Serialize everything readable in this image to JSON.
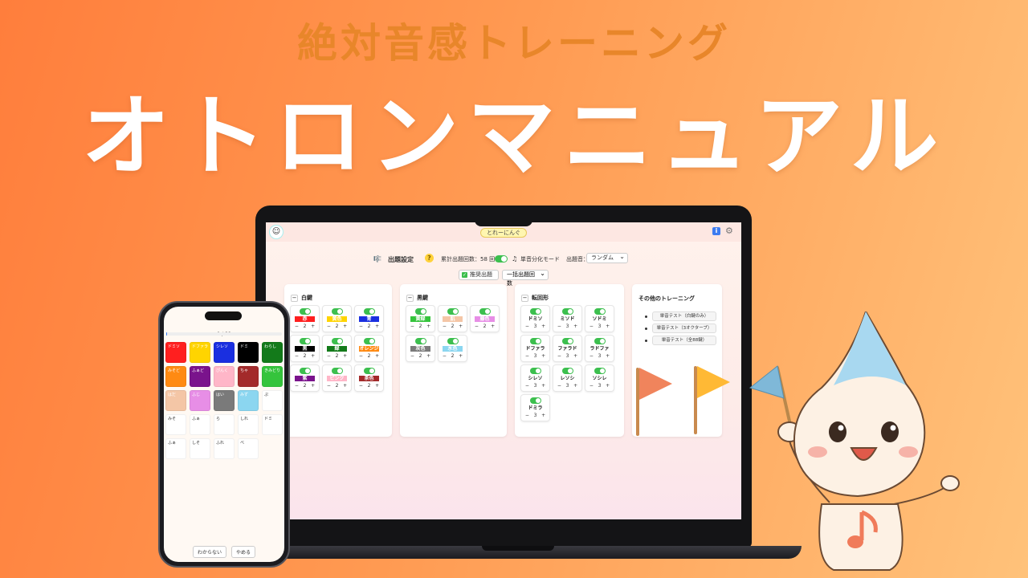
{
  "hero": {
    "subtitle": "絶対音感トレーニング",
    "title": "オトロンマニュアル"
  },
  "app": {
    "profile_name": "とれーにんぐ",
    "info_label": "i",
    "settings": {
      "title": "出題設定",
      "count_label": "累計出題回数：58 回",
      "mode_label": "単音分化モード",
      "sound_label": "出題音：",
      "sound_value": "ランダム",
      "recommend_label": "推奨出題",
      "bulk_label": "一括出題回数"
    },
    "white_keys": {
      "title": "白鍵",
      "cards": [
        {
          "label": "赤",
          "color": "#ff1f1f",
          "count": "2"
        },
        {
          "label": "黄色",
          "color": "#ffd400",
          "count": "2"
        },
        {
          "label": "青",
          "color": "#1a2fe0",
          "count": "2"
        },
        {
          "label": "黒",
          "color": "#000000",
          "count": "2"
        },
        {
          "label": "緑",
          "color": "#137a1a",
          "count": "2"
        },
        {
          "label": "オレンジ",
          "color": "#ff8a12",
          "count": "2"
        },
        {
          "label": "紫",
          "color": "#7a138c",
          "count": "2"
        },
        {
          "label": "ピンク",
          "color": "#ffb6c8",
          "count": "2"
        },
        {
          "label": "茶色",
          "color": "#a32a2a",
          "count": "2"
        }
      ]
    },
    "black_keys": {
      "title": "黒鍵",
      "cards": [
        {
          "label": "黄緑",
          "color": "#35c43c",
          "count": "2"
        },
        {
          "label": "肌",
          "color": "#f4c6a6",
          "count": "2"
        },
        {
          "label": "藤色",
          "color": "#e78ee6",
          "count": "2"
        },
        {
          "label": "灰色",
          "color": "#7a7a7a",
          "count": "2"
        },
        {
          "label": "水色",
          "color": "#8bd6f0",
          "count": "2"
        }
      ]
    },
    "inversions": {
      "title": "転回形",
      "cards": [
        {
          "label": "ドミソ",
          "count": "3"
        },
        {
          "label": "ミソド",
          "count": "3"
        },
        {
          "label": "ソドミ",
          "count": "3"
        },
        {
          "label": "ドファラ",
          "count": "3"
        },
        {
          "label": "ファラド",
          "count": "3"
        },
        {
          "label": "ラドファ",
          "count": "3"
        },
        {
          "label": "シレソ",
          "count": "3"
        },
        {
          "label": "レソシ",
          "count": "3"
        },
        {
          "label": "ソシレ",
          "count": "3"
        },
        {
          "label": "ドミラ",
          "count": "3"
        }
      ]
    },
    "other": {
      "title": "その他のトレーニング",
      "items": [
        "単音テスト（白鍵のみ）",
        "単音テスト（3オクターブ）",
        "単音テスト（全88鍵）"
      ]
    }
  },
  "phone": {
    "counter": "1 / 88",
    "progress": 0.01,
    "keys": [
      {
        "text": "ドミソ",
        "color": "#ff1f1f"
      },
      {
        "text": "ドファラ",
        "color": "#ffd400"
      },
      {
        "text": "シレソ",
        "color": "#1a2fe0"
      },
      {
        "text": "ドミ",
        "color": "#000000"
      },
      {
        "text": "わらし",
        "color": "#137a1a"
      },
      {
        "text": "みそど",
        "color": "#ff8a12"
      },
      {
        "text": "ふぁど",
        "color": "#7a138c"
      },
      {
        "text": "ぴんく",
        "color": "#ffb6c8"
      },
      {
        "text": "ちゃ",
        "color": "#a32a2a"
      },
      {
        "text": "きみどり",
        "color": "#35c43c"
      },
      {
        "text": "はだ",
        "color": "#f4c6a6"
      },
      {
        "text": "ふじ",
        "color": "#e78ee6"
      },
      {
        "text": "はい",
        "color": "#7a7a7a"
      },
      {
        "text": "みず",
        "color": "#8bd6f0"
      },
      {
        "text": "ぷ",
        "color": ""
      },
      {
        "text": "みそ",
        "color": ""
      },
      {
        "text": "ふぁ",
        "color": ""
      },
      {
        "text": "ら",
        "color": ""
      },
      {
        "text": "しれ",
        "color": ""
      },
      {
        "text": "ドミ",
        "color": ""
      },
      {
        "text": "ふぁ",
        "color": ""
      },
      {
        "text": "しそ",
        "color": ""
      },
      {
        "text": "ふれ",
        "color": ""
      },
      {
        "text": "べ",
        "color": ""
      }
    ],
    "btn_unknown": "わからない",
    "btn_quit": "やめる"
  }
}
